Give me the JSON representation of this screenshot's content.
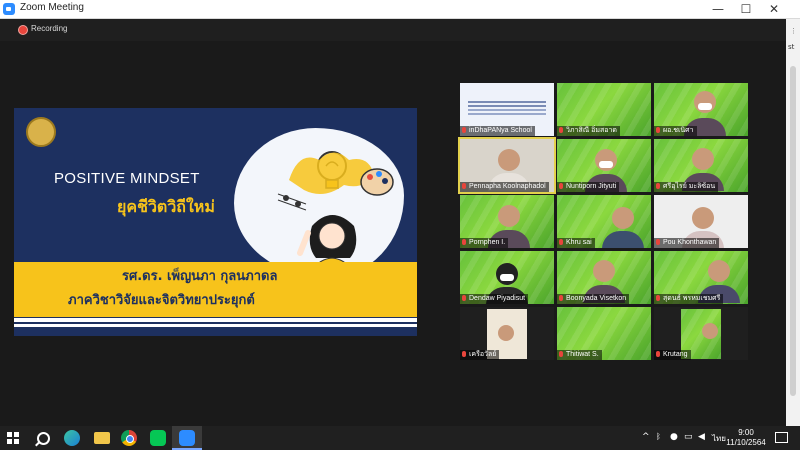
{
  "window": {
    "title": "Zoom Meeting",
    "minimize": "—",
    "maximize": "☐",
    "close": "✕"
  },
  "recording": {
    "label": "Recording"
  },
  "edge_fragment": "st",
  "shared_slide": {
    "title": "POSITIVE MINDSET",
    "subtitle": "ยุคชีวิตวิถีใหม่",
    "author": "รศ.ดร. เพ็ญนภา กุลนภาดล",
    "department": "ภาควิชาวิจัยและจิตวิทยาประยุกต์"
  },
  "participants": [
    {
      "name": "inDhaPANya School"
    },
    {
      "name": "วิภาสิณี  อิ่มสอาด"
    },
    {
      "name": "ผอ.ชเนิศา"
    },
    {
      "name": "Pennapha Koolnaphadol"
    },
    {
      "name": "Nuntiporn Jityuti"
    },
    {
      "name": "ศรีอุไรย์  มะลิซ้อน"
    },
    {
      "name": "Pornphen I."
    },
    {
      "name": "Khru sai"
    },
    {
      "name": "Pou Khonthawan"
    },
    {
      "name": "Dendaw Piyadisut"
    },
    {
      "name": "Boonyada Visetkon"
    },
    {
      "name": "สุดนธ์ พรหมเชมศรี"
    },
    {
      "name": "เครือวัลย์"
    },
    {
      "name": "Thitiwat S."
    },
    {
      "name": "Krutang"
    }
  ],
  "taskbar": {
    "icons": [
      "windows-start-icon",
      "search-icon",
      "edge-browser-icon",
      "file-explorer-icon",
      "chrome-icon",
      "line-app-icon",
      "zoom-app-icon"
    ],
    "tray": {
      "chevron": "^",
      "language": "ไทย"
    },
    "clock": {
      "time": "9:00",
      "date": "11/10/2564"
    }
  }
}
